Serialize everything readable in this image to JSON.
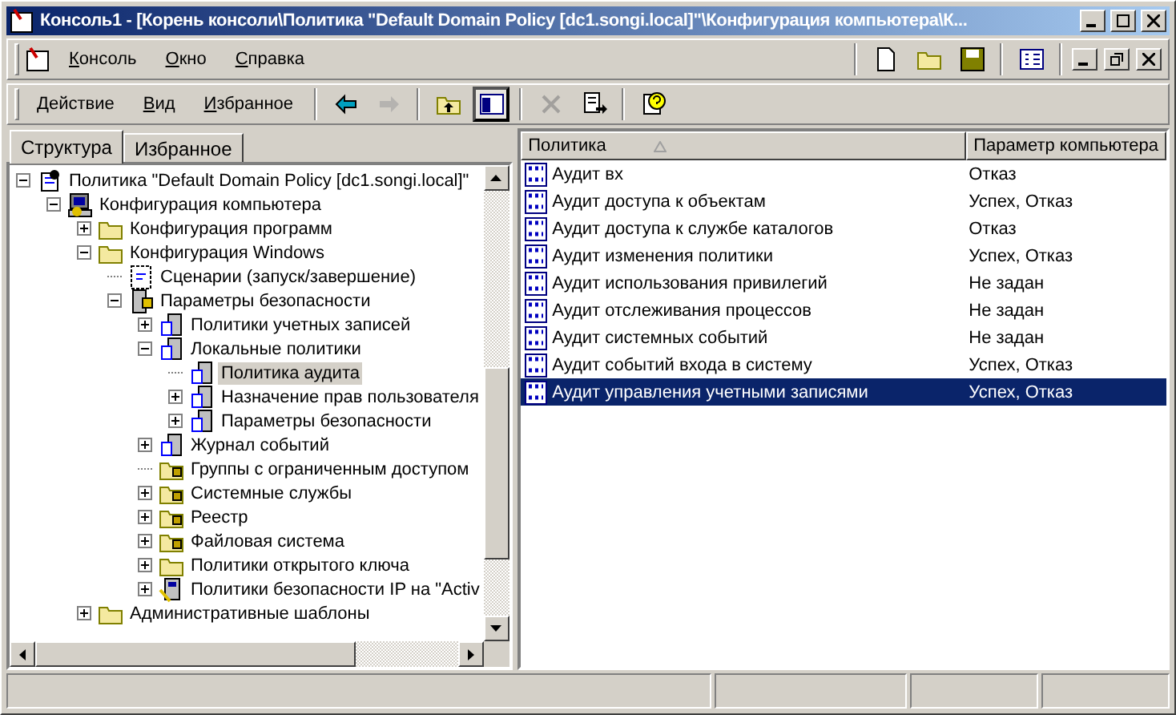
{
  "window": {
    "title": "Консоль1 - [Корень консоли\\Политика \"Default Domain Policy [dc1.songi.local]\"\\Конфигурация компьютера\\К..."
  },
  "menu": [
    "Консоль",
    "Окно",
    "Справка"
  ],
  "action_menu": [
    "Действие",
    "Вид",
    "Избранное"
  ],
  "toolbar": [
    {
      "kind": "back",
      "disabled": false,
      "pressed": false
    },
    {
      "kind": "forward",
      "disabled": true,
      "pressed": false
    },
    {
      "kind": "up",
      "disabled": false,
      "pressed": false
    },
    {
      "kind": "tree-toggle",
      "disabled": false,
      "pressed": true
    },
    {
      "kind": "delete",
      "disabled": true,
      "pressed": false
    },
    {
      "kind": "export",
      "disabled": false,
      "pressed": false
    },
    {
      "kind": "help",
      "disabled": false,
      "pressed": false
    }
  ],
  "tabs": [
    {
      "label": "Структура",
      "selected": true
    },
    {
      "label": "Избранное",
      "selected": false
    }
  ],
  "tree": [
    {
      "label": "Политика \"Default Domain Policy [dc1.songi.local]\"",
      "kind": "policy",
      "expanded": true,
      "selected": false,
      "children": [
        {
          "label": "Конфигурация компьютера",
          "kind": "computer",
          "expanded": true,
          "selected": false,
          "children": [
            {
              "label": "Конфигурация программ",
              "kind": "folder",
              "expanded": false,
              "selected": false
            },
            {
              "label": "Конфигурация Windows",
              "kind": "folder",
              "expanded": true,
              "selected": false,
              "children": [
                {
                  "label": "Сценарии (запуск/завершение)",
                  "kind": "script",
                  "selected": false
                },
                {
                  "label": "Параметры безопасности",
                  "kind": "security",
                  "expanded": true,
                  "selected": false,
                  "children": [
                    {
                      "label": "Политики учетных записей",
                      "kind": "servers",
                      "expanded": false,
                      "selected": false
                    },
                    {
                      "label": "Локальные политики",
                      "kind": "servers",
                      "expanded": true,
                      "selected": false,
                      "children": [
                        {
                          "label": "Политика аудита",
                          "kind": "servers",
                          "selected": true
                        },
                        {
                          "label": "Назначение прав пользователя",
                          "kind": "servers",
                          "expanded": false,
                          "selected": false
                        },
                        {
                          "label": "Параметры безопасности",
                          "kind": "servers",
                          "expanded": false,
                          "selected": false
                        }
                      ]
                    },
                    {
                      "label": "Журнал событий",
                      "kind": "servers",
                      "expanded": false,
                      "selected": false
                    },
                    {
                      "label": "Группы с ограниченным доступом",
                      "kind": "lock-folder",
                      "selected": false
                    },
                    {
                      "label": "Системные службы",
                      "kind": "lock-folder",
                      "expanded": false,
                      "selected": false
                    },
                    {
                      "label": "Реестр",
                      "kind": "lock-folder",
                      "expanded": false,
                      "selected": false
                    },
                    {
                      "label": "Файловая система",
                      "kind": "lock-folder",
                      "expanded": false,
                      "selected": false
                    },
                    {
                      "label": "Политики открытого ключа",
                      "kind": "folder",
                      "expanded": false,
                      "selected": false
                    },
                    {
                      "label": "Политики безопасности IP на \"Activ",
                      "kind": "ip",
                      "expanded": false,
                      "selected": false
                    }
                  ]
                }
              ]
            },
            {
              "label": "Административные шаблоны",
              "kind": "folder",
              "expanded": false,
              "selected": false
            }
          ]
        }
      ]
    }
  ],
  "list": {
    "columns": [
      "Политика",
      "Параметр компьютера"
    ],
    "rows": [
      {
        "policy": "Аудит вх",
        "setting": "Отказ",
        "selected": false
      },
      {
        "policy": "Аудит доступа к объектам",
        "setting": "Успех, Отказ",
        "selected": false
      },
      {
        "policy": "Аудит доступа к службе каталогов",
        "setting": "Отказ",
        "selected": false
      },
      {
        "policy": "Аудит изменения политики",
        "setting": "Успех, Отказ",
        "selected": false
      },
      {
        "policy": "Аудит использования привилегий",
        "setting": "Не задан",
        "selected": false
      },
      {
        "policy": "Аудит отслеживания процессов",
        "setting": "Не задан",
        "selected": false
      },
      {
        "policy": "Аудит системных событий",
        "setting": "Не задан",
        "selected": false
      },
      {
        "policy": "Аудит событий входа в систему",
        "setting": "Успех, Отказ",
        "selected": false
      },
      {
        "policy": "Аудит управления учетными записями",
        "setting": "Успех, Отказ",
        "selected": true
      }
    ]
  }
}
